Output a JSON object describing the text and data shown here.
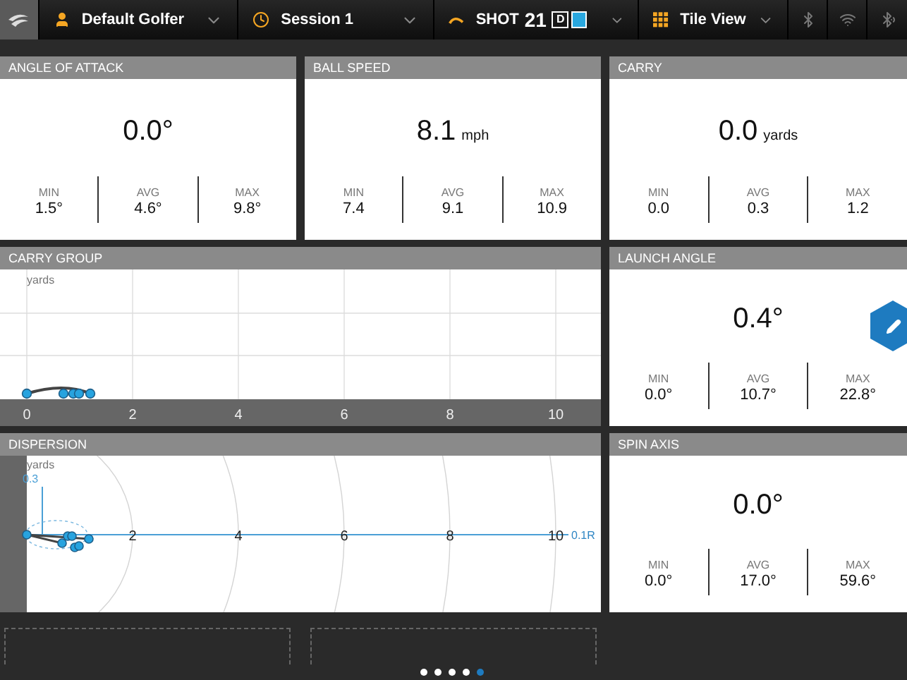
{
  "toolbar": {
    "golfer": "Default Golfer",
    "session": "Session 1",
    "shot_label": "SHOT",
    "shot_number": "21",
    "shot_badge": "D",
    "view": "Tile View"
  },
  "top_tiles": [
    {
      "title": "ANGLE OF ATTACK",
      "value": "0.0°",
      "stats": [
        {
          "label": "MIN",
          "value": "1.5°"
        },
        {
          "label": "AVG",
          "value": "4.6°"
        },
        {
          "label": "MAX",
          "value": "9.8°"
        }
      ]
    },
    {
      "title": "BALL SPEED",
      "value": "8.1",
      "unit": "mph",
      "stats": [
        {
          "label": "MIN",
          "value": "7.4"
        },
        {
          "label": "AVG",
          "value": "9.1"
        },
        {
          "label": "MAX",
          "value": "10.9"
        }
      ]
    },
    {
      "title": "CARRY",
      "value": "0.0",
      "unit": "yards",
      "stats": [
        {
          "label": "MIN",
          "value": "0.0"
        },
        {
          "label": "AVG",
          "value": "0.3"
        },
        {
          "label": "MAX",
          "value": "1.2"
        }
      ]
    }
  ],
  "carry_group": {
    "title": "CARRY GROUP",
    "unit": "yards",
    "ticks": [
      "0",
      "2",
      "4",
      "6",
      "8",
      "10"
    ]
  },
  "launch_angle": {
    "title": "LAUNCH ANGLE",
    "value": "0.4°",
    "editable": true,
    "stats": [
      {
        "label": "MIN",
        "value": "0.0°"
      },
      {
        "label": "AVG",
        "value": "10.7°"
      },
      {
        "label": "MAX",
        "value": "22.8°"
      }
    ]
  },
  "dispersion": {
    "title": "DISPERSION",
    "unit": "yards",
    "lateral_label": "0.3",
    "offset_label": "0.1R",
    "ticks": [
      "2",
      "4",
      "6",
      "8",
      "10"
    ]
  },
  "spin_axis": {
    "title": "SPIN AXIS",
    "value": "0.0°",
    "stats": [
      {
        "label": "MIN",
        "value": "0.0°"
      },
      {
        "label": "AVG",
        "value": "17.0°"
      },
      {
        "label": "MAX",
        "value": "59.6°"
      }
    ]
  },
  "pages": [
    {
      "selected": false
    },
    {
      "selected": false
    },
    {
      "selected": false
    },
    {
      "selected": false
    },
    {
      "selected": true
    }
  ]
}
